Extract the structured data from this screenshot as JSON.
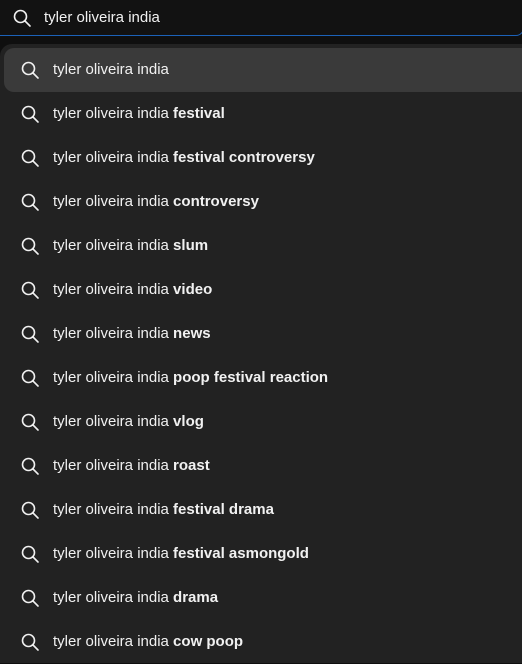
{
  "search": {
    "value": "tyler oliveira india",
    "icon": "search-icon"
  },
  "suggestions": [
    {
      "query": "tyler oliveira india",
      "completion": ""
    },
    {
      "query": "tyler oliveira india",
      "completion": " festival"
    },
    {
      "query": "tyler oliveira india",
      "completion": " festival controversy"
    },
    {
      "query": "tyler oliveira india",
      "completion": " controversy"
    },
    {
      "query": "tyler oliveira india",
      "completion": " slum"
    },
    {
      "query": "tyler oliveira india",
      "completion": " video"
    },
    {
      "query": "tyler oliveira india",
      "completion": " news"
    },
    {
      "query": "tyler oliveira india",
      "completion": " poop festival reaction"
    },
    {
      "query": "tyler oliveira india",
      "completion": " vlog"
    },
    {
      "query": "tyler oliveira india",
      "completion": " roast"
    },
    {
      "query": "tyler oliveira india",
      "completion": " festival drama"
    },
    {
      "query": "tyler oliveira india",
      "completion": " festival asmongold"
    },
    {
      "query": "tyler oliveira india",
      "completion": " drama"
    },
    {
      "query": "tyler oliveira india",
      "completion": " cow poop"
    }
  ],
  "colors": {
    "accent": "#1c62b9",
    "dropdown_bg": "#222222",
    "highlight_bg": "#3a3a3a",
    "text": "#f1f1f1"
  }
}
